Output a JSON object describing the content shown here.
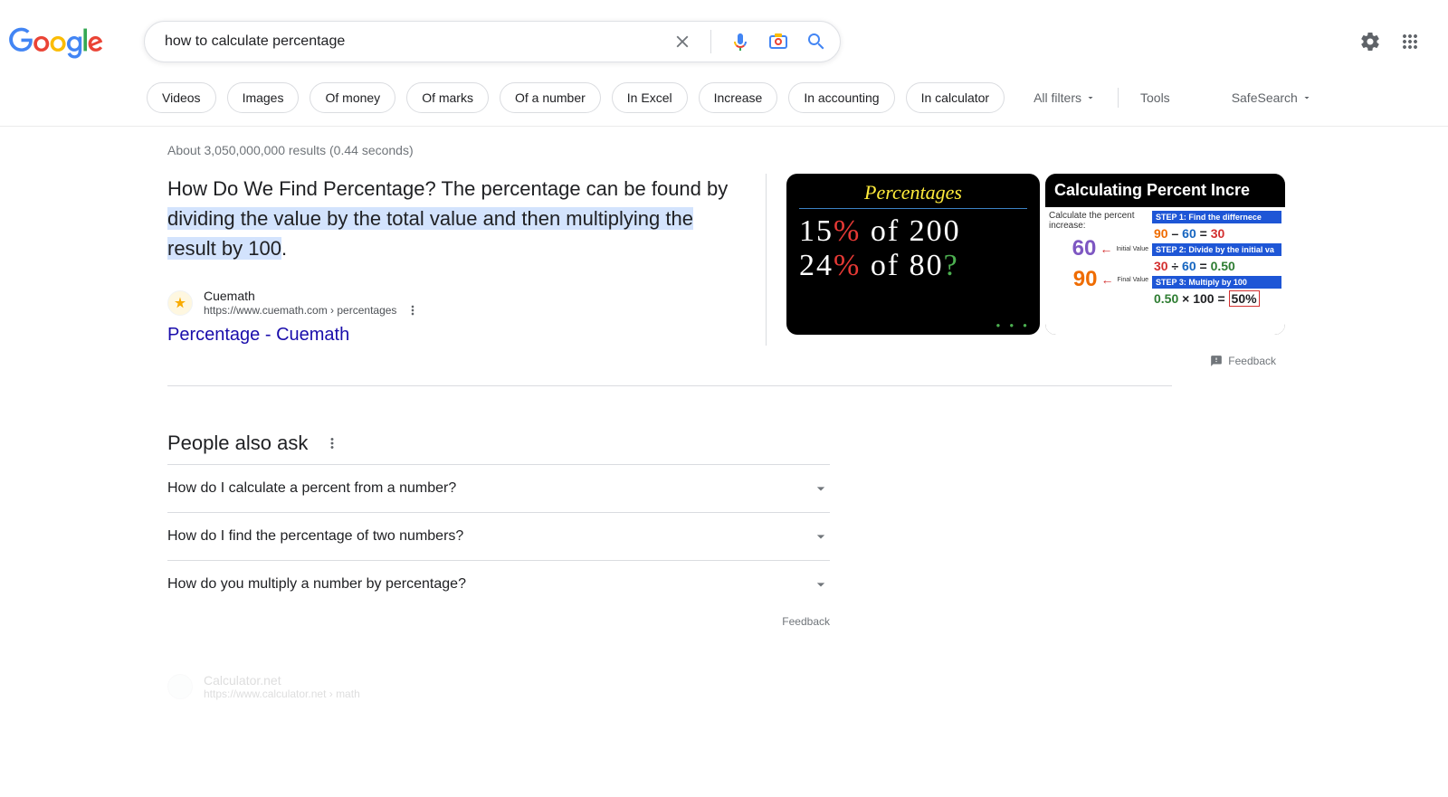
{
  "search": {
    "query": "how to calculate percentage"
  },
  "chips": [
    "Videos",
    "Images",
    "Of money",
    "Of marks",
    "Of a number",
    "In Excel",
    "Increase",
    "In accounting",
    "In calculator"
  ],
  "toolbar": {
    "all_filters": "All filters",
    "tools": "Tools",
    "safesearch": "SafeSearch"
  },
  "stats": "About 3,050,000,000 results (0.44 seconds)",
  "snippet": {
    "plain": "How Do We Find Percentage? The percentage can be found by ",
    "highlight": "dividing the value by the total value and then multiplying the result by 100",
    "tail": "."
  },
  "source": {
    "name": "Cuemath",
    "url": "https://www.cuemath.com › percentages",
    "title": "Percentage - Cuemath"
  },
  "thumb1": {
    "title": "Percentages",
    "line1a": "15",
    "line1b": "%",
    "line1c": " of 200",
    "line2a": "24",
    "line2b": "%",
    "line2c": " of 80",
    "q": "?"
  },
  "thumb2": {
    "title": "Calculating Percent Incre",
    "calc_label": "Calculate the percent increase:",
    "v60": "60",
    "v90": "90",
    "initial": "Initial Value",
    "final": "Final Value",
    "step1": "STEP 1:  Find the differnece",
    "eq1a": "90",
    "eq1b": " – ",
    "eq1c": "60",
    "eq1d": " = ",
    "eq1e": "30",
    "step2": "STEP 2:  Divide by the initial va",
    "eq2a": "30",
    "eq2b": " ÷ ",
    "eq2c": "60",
    "eq2d": " = ",
    "eq2e": "0.50",
    "step3": "STEP 3:  Multiply by 100",
    "eq3a": "0.50",
    "eq3b": " × ",
    "eq3c": "100",
    "eq3d": " = ",
    "eq3e": "50%"
  },
  "feedback": "Feedback",
  "paa": {
    "title": "People also ask",
    "items": [
      "How do I calculate a percent from a number?",
      "How do I find the percentage of two numbers?",
      "How do you multiply a number by percentage?"
    ],
    "feedback": "Feedback"
  },
  "faded": {
    "name": "Calculator.net",
    "url": "https://www.calculator.net › math"
  }
}
